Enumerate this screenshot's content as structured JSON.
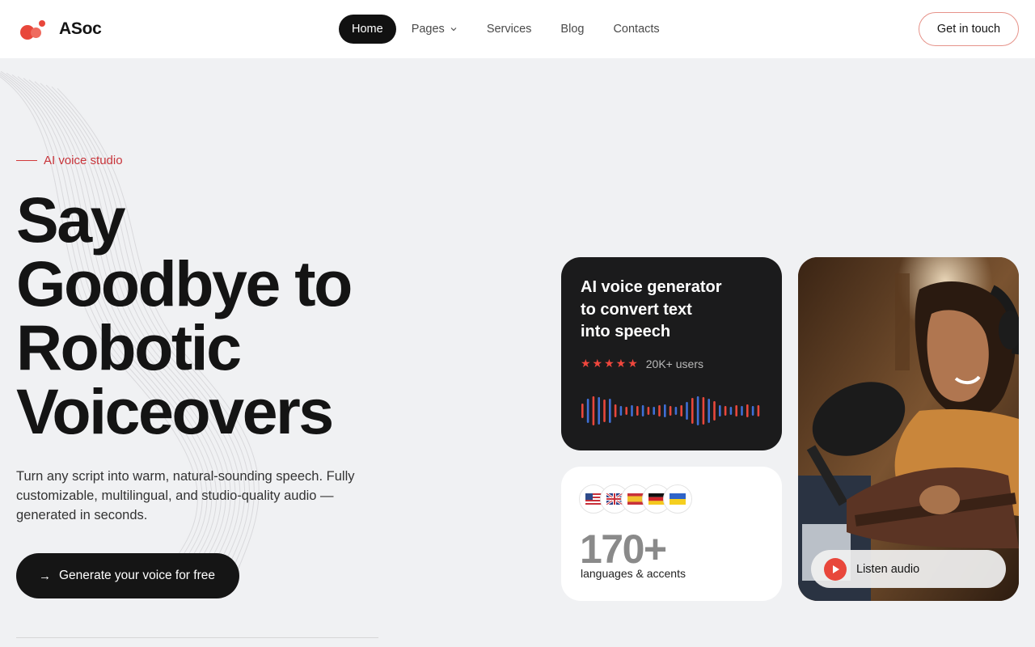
{
  "header": {
    "brand": "ASoc",
    "nav": [
      {
        "label": "Home",
        "active": true
      },
      {
        "label": "Pages",
        "has_dropdown": true
      },
      {
        "label": "Services"
      },
      {
        "label": "Blog"
      },
      {
        "label": "Contacts"
      }
    ],
    "cta_label": "Get in touch"
  },
  "hero": {
    "eyebrow": "AI voice studio",
    "title_lines": [
      "Say",
      "Goodbye to",
      "Robotic",
      "Voiceovers"
    ],
    "description": "Turn any script into warm, natural-sounding speech. Fully customizable, multilingual, and studio-quality audio — generated in seconds.",
    "cta_label": "Generate your voice for free"
  },
  "voice_card": {
    "title_lines": [
      "AI voice generator",
      "to convert text",
      "into speech"
    ],
    "stars": "★★★★★",
    "rating_count": 5,
    "users": "20K+ users"
  },
  "languages_card": {
    "flags": [
      "us-flag-icon",
      "uk-flag-icon",
      "spain-flag-icon",
      "germany-flag-icon",
      "ukraine-flag-icon"
    ],
    "number": "170+",
    "label": "languages & accents"
  },
  "photo_card": {
    "listen_label": "Listen audio"
  },
  "colors": {
    "accent": "#e8473b",
    "dark": "#151515",
    "background": "#f0f1f3",
    "wave_red": "#e8473b",
    "wave_blue": "#3f6fd6"
  }
}
